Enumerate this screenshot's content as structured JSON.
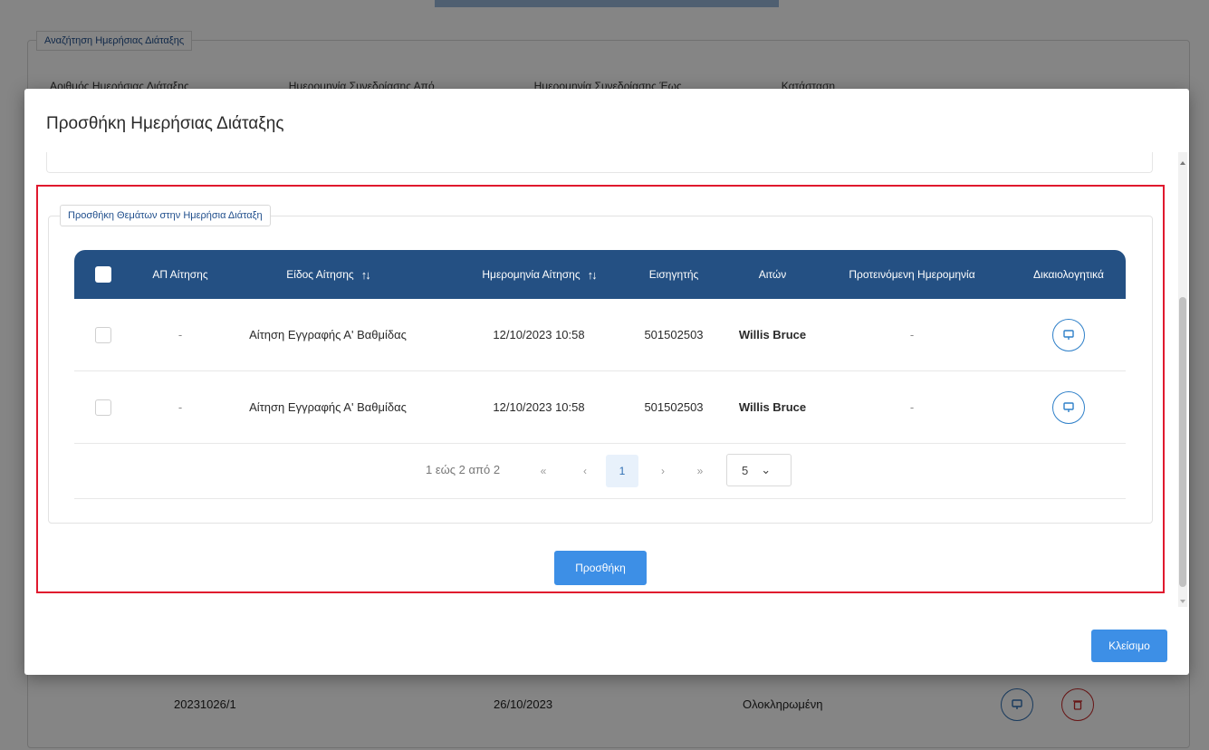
{
  "background": {
    "search_legend": "Αναζήτηση Ημερήσιας Διάταξης",
    "filter_labels": [
      "Αριθμός Ημερήσιας Διάταξης",
      "Ημερομηνία Συνεδρίασης Από",
      "Ημερομηνία Συνεδρίασης Έως",
      "Κατάσταση"
    ],
    "row": {
      "number": "20231026/1",
      "date": "26/10/2023",
      "status": "Ολοκληρωμένη"
    }
  },
  "modal": {
    "title": "Προσθήκη Ημερήσιας Διάταξης",
    "section_legend": "Προσθήκη Θεμάτων στην Ημερήσια Διάταξη",
    "columns": [
      "ΑΠ Αίτησης",
      "Είδος Αίτησης",
      "Ημερομηνία Αίτησης",
      "Εισηγητής",
      "Αιτών",
      "Προτεινόμενη Ημερομηνία",
      "Δικαιολογητικά"
    ],
    "sort_glyph": "↑↓",
    "rows": [
      {
        "ap": "-",
        "type": "Αίτηση Εγγραφής Α' Βαθμίδας",
        "date": "12/10/2023 10:58",
        "rapporteur": "501502503",
        "applicant": "Willis Bruce",
        "proposed": "-"
      },
      {
        "ap": "-",
        "type": "Αίτηση Εγγραφής Α' Βαθμίδας",
        "date": "12/10/2023 10:58",
        "rapporteur": "501502503",
        "applicant": "Willis Bruce",
        "proposed": "-"
      }
    ],
    "pagination": {
      "info": "1 εώς 2 από 2",
      "first": "«",
      "prev": "‹",
      "current_page": "1",
      "next": "›",
      "last": "»",
      "page_size": "5",
      "chevron": "⌄"
    },
    "add_button": "Προσθήκη",
    "close_button": "Κλείσιμο"
  },
  "colors": {
    "header_bg": "#245083",
    "primary_button": "#3d8fe6",
    "highlight_border": "#e0192e"
  }
}
